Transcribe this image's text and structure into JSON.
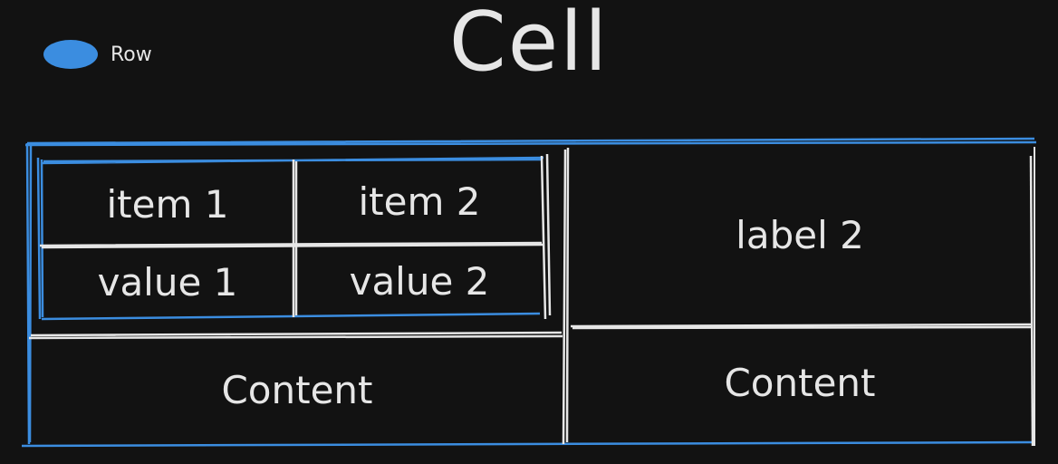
{
  "legend": {
    "label": "Row",
    "color": "#3b8de0"
  },
  "title": "Cell",
  "colors": {
    "row": "#3b8de0",
    "line": "#e6e6e6",
    "background": "#121212"
  },
  "table": {
    "inner": {
      "headers": [
        "item 1",
        "item 2"
      ],
      "values": [
        "value 1",
        "value 2"
      ]
    },
    "right_label": "label 2",
    "bottom": [
      "Content",
      "Content"
    ]
  }
}
